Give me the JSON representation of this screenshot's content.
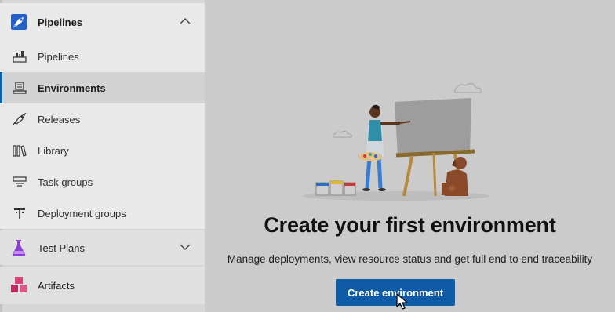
{
  "sidebar": {
    "pipelines_section": {
      "label": "Pipelines",
      "icon": "pipelines-rocket-icon",
      "expanded": true
    },
    "items": [
      {
        "label": "Pipelines",
        "icon": "pipeline-icon"
      },
      {
        "label": "Environments",
        "icon": "environment-icon",
        "active": true
      },
      {
        "label": "Releases",
        "icon": "rocket-icon"
      },
      {
        "label": "Library",
        "icon": "library-icon"
      },
      {
        "label": "Task groups",
        "icon": "task-groups-icon"
      },
      {
        "label": "Deployment groups",
        "icon": "deployment-groups-icon"
      }
    ],
    "test_plans_section": {
      "label": "Test Plans",
      "icon": "flask-icon",
      "expanded": false
    },
    "artifacts_section": {
      "label": "Artifacts",
      "icon": "package-icon"
    }
  },
  "main": {
    "headline": "Create your first environment",
    "description": "Manage deployments, view resource status and get full end to end traceability",
    "create_button_label": "Create environment",
    "accent_color": "#0f5ba5"
  }
}
